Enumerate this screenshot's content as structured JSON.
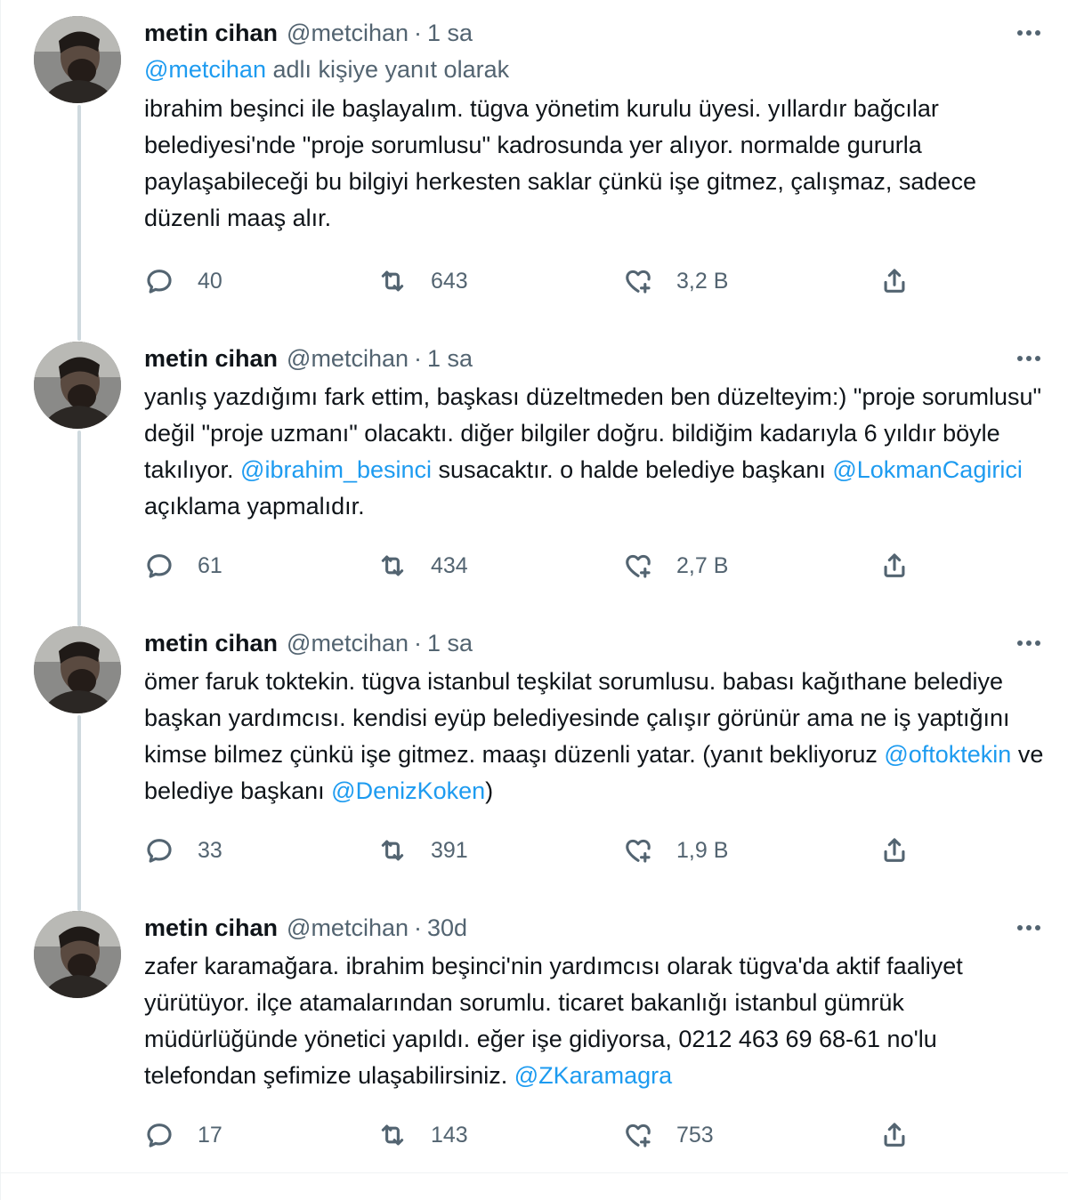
{
  "tweets": [
    {
      "name": "metin cihan",
      "handle": "@metcihan",
      "separator": "·",
      "time": "1 sa",
      "reply_mention": "@metcihan",
      "reply_suffix": " adlı kişiye yanıt olarak",
      "segments": [
        {
          "text": "ibrahim beşinci ile başlayalım. tügva yönetim kurulu üyesi. yıllardır bağcılar belediyesi'nde \"proje sorumlusu\" kadrosunda yer alıyor. normalde gururla paylaşabileceği bu bilgiyi herkesten saklar çünkü işe gitmez, çalışmaz, sadece düzenli maaş alır.",
          "mention": false
        }
      ],
      "replies": "40",
      "retweets": "643",
      "likes": "3,2 B"
    },
    {
      "name": "metin cihan",
      "handle": "@metcihan",
      "separator": "·",
      "time": "1 sa",
      "segments": [
        {
          "text": "yanlış yazdığımı fark ettim, başkası düzeltmeden ben düzelteyim:) \"proje sorumlusu\" değil \"proje uzmanı\" olacaktı. diğer bilgiler doğru. bildiğim kadarıyla 6 yıldır böyle takılıyor. ",
          "mention": false
        },
        {
          "text": "@ibrahim_besinci",
          "mention": true
        },
        {
          "text": " susacaktır. o halde belediye başkanı ",
          "mention": false
        },
        {
          "text": "@LokmanCagirici",
          "mention": true
        },
        {
          "text": " açıklama yapmalıdır.",
          "mention": false
        }
      ],
      "replies": "61",
      "retweets": "434",
      "likes": "2,7 B"
    },
    {
      "name": "metin cihan",
      "handle": "@metcihan",
      "separator": "·",
      "time": "1 sa",
      "segments": [
        {
          "text": "ömer faruk toktekin. tügva istanbul teşkilat sorumlusu. babası kağıthane belediye başkan yardımcısı. kendisi eyüp belediyesinde çalışır görünür ama ne iş yaptığını kimse bilmez çünkü işe gitmez. maaşı düzenli yatar. (yanıt bekliyoruz ",
          "mention": false
        },
        {
          "text": "@oftoktekin",
          "mention": true
        },
        {
          "text": " ve belediye başkanı ",
          "mention": false
        },
        {
          "text": "@DenizKoken",
          "mention": true
        },
        {
          "text": ")",
          "mention": false
        }
      ],
      "replies": "33",
      "retweets": "391",
      "likes": "1,9 B"
    },
    {
      "name": "metin cihan",
      "handle": "@metcihan",
      "separator": "·",
      "time": "30d",
      "segments": [
        {
          "text": "zafer karamağara. ibrahim beşinci'nin yardımcısı olarak tügva'da aktif faaliyet yürütüyor. ilçe atamalarından sorumlu. ticaret bakanlığı istanbul gümrük müdürlüğünde yönetici yapıldı. eğer işe gidiyorsa, 0212 463 69 68-61 no'lu telefondan şefimize ulaşabilirsiniz. ",
          "mention": false
        },
        {
          "text": "@ZKaramagra",
          "mention": true
        }
      ],
      "replies": "17",
      "retweets": "143",
      "likes": "753"
    }
  ],
  "icons": {
    "reply": "reply-icon",
    "retweet": "retweet-icon",
    "like": "like-icon",
    "share": "share-icon",
    "more": "more-icon"
  },
  "colors": {
    "mention": "#1d9bf0",
    "secondary_text": "#536471",
    "thread_line": "#cfd9de"
  }
}
